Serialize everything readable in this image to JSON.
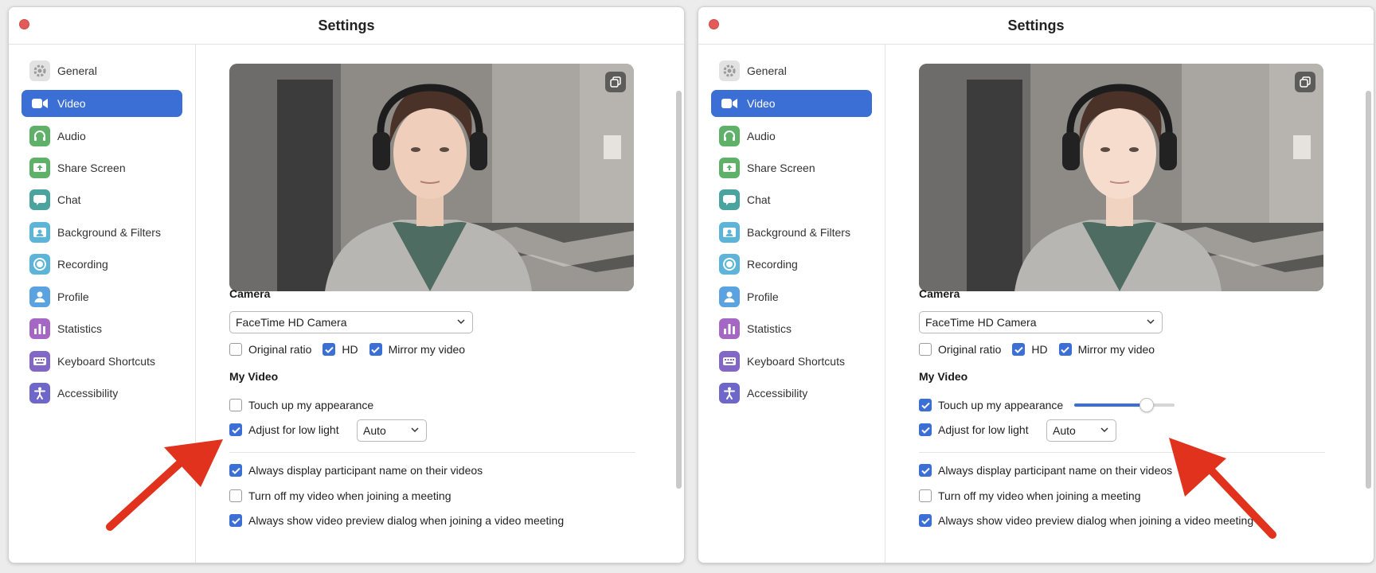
{
  "windows": [
    {
      "title": "Settings",
      "sidebar": {
        "items": [
          {
            "label": "General",
            "icon": "gear-icon",
            "active": false
          },
          {
            "label": "Video",
            "icon": "video-camera-icon",
            "active": true
          },
          {
            "label": "Audio",
            "icon": "headphones-icon",
            "active": false
          },
          {
            "label": "Share Screen",
            "icon": "share-screen-icon",
            "active": false
          },
          {
            "label": "Chat",
            "icon": "chat-bubble-icon",
            "active": false
          },
          {
            "label": "Background & Filters",
            "icon": "background-icon",
            "active": false
          },
          {
            "label": "Recording",
            "icon": "record-icon",
            "active": false
          },
          {
            "label": "Profile",
            "icon": "person-icon",
            "active": false
          },
          {
            "label": "Statistics",
            "icon": "bar-chart-icon",
            "active": false
          },
          {
            "label": "Keyboard Shortcuts",
            "icon": "keyboard-icon",
            "active": false
          },
          {
            "label": "Accessibility",
            "icon": "accessibility-icon",
            "active": false
          }
        ]
      },
      "camera": {
        "heading": "Camera",
        "selected": "FaceTime HD Camera",
        "original_ratio": {
          "label": "Original ratio",
          "checked": false
        },
        "hd": {
          "label": "HD",
          "checked": true
        },
        "mirror": {
          "label": "Mirror my video",
          "checked": true
        }
      },
      "my_video": {
        "heading": "My Video",
        "touch_up": {
          "label": "Touch up my appearance",
          "checked": false,
          "slider_level": null
        },
        "low_light": {
          "label": "Adjust for low light",
          "checked": true,
          "mode": "Auto"
        }
      },
      "options": [
        {
          "label": "Always display participant name on their videos",
          "checked": true
        },
        {
          "label": "Turn off my video when joining a meeting",
          "checked": false
        },
        {
          "label": "Always show video preview dialog when joining a video meeting",
          "checked": true
        }
      ]
    },
    {
      "title": "Settings",
      "sidebar": {
        "items": [
          {
            "label": "General",
            "icon": "gear-icon",
            "active": false
          },
          {
            "label": "Video",
            "icon": "video-camera-icon",
            "active": true
          },
          {
            "label": "Audio",
            "icon": "headphones-icon",
            "active": false
          },
          {
            "label": "Share Screen",
            "icon": "share-screen-icon",
            "active": false
          },
          {
            "label": "Chat",
            "icon": "chat-bubble-icon",
            "active": false
          },
          {
            "label": "Background & Filters",
            "icon": "background-icon",
            "active": false
          },
          {
            "label": "Recording",
            "icon": "record-icon",
            "active": false
          },
          {
            "label": "Profile",
            "icon": "person-icon",
            "active": false
          },
          {
            "label": "Statistics",
            "icon": "bar-chart-icon",
            "active": false
          },
          {
            "label": "Keyboard Shortcuts",
            "icon": "keyboard-icon",
            "active": false
          },
          {
            "label": "Accessibility",
            "icon": "accessibility-icon",
            "active": false
          }
        ]
      },
      "camera": {
        "heading": "Camera",
        "selected": "FaceTime HD Camera",
        "original_ratio": {
          "label": "Original ratio",
          "checked": false
        },
        "hd": {
          "label": "HD",
          "checked": true
        },
        "mirror": {
          "label": "Mirror my video",
          "checked": true
        }
      },
      "my_video": {
        "heading": "My Video",
        "touch_up": {
          "label": "Touch up my appearance",
          "checked": true,
          "slider_level": 0.72
        },
        "low_light": {
          "label": "Adjust for low light",
          "checked": true,
          "mode": "Auto"
        }
      },
      "options": [
        {
          "label": "Always display participant name on their videos",
          "checked": true
        },
        {
          "label": "Turn off my video when joining a meeting",
          "checked": false
        },
        {
          "label": "Always show video preview dialog when joining a video meeting",
          "checked": true
        }
      ]
    }
  ],
  "colors": {
    "accent": "#3b6fd6",
    "close_button": "#e25b59",
    "annotation_arrow": "#e0321c"
  }
}
